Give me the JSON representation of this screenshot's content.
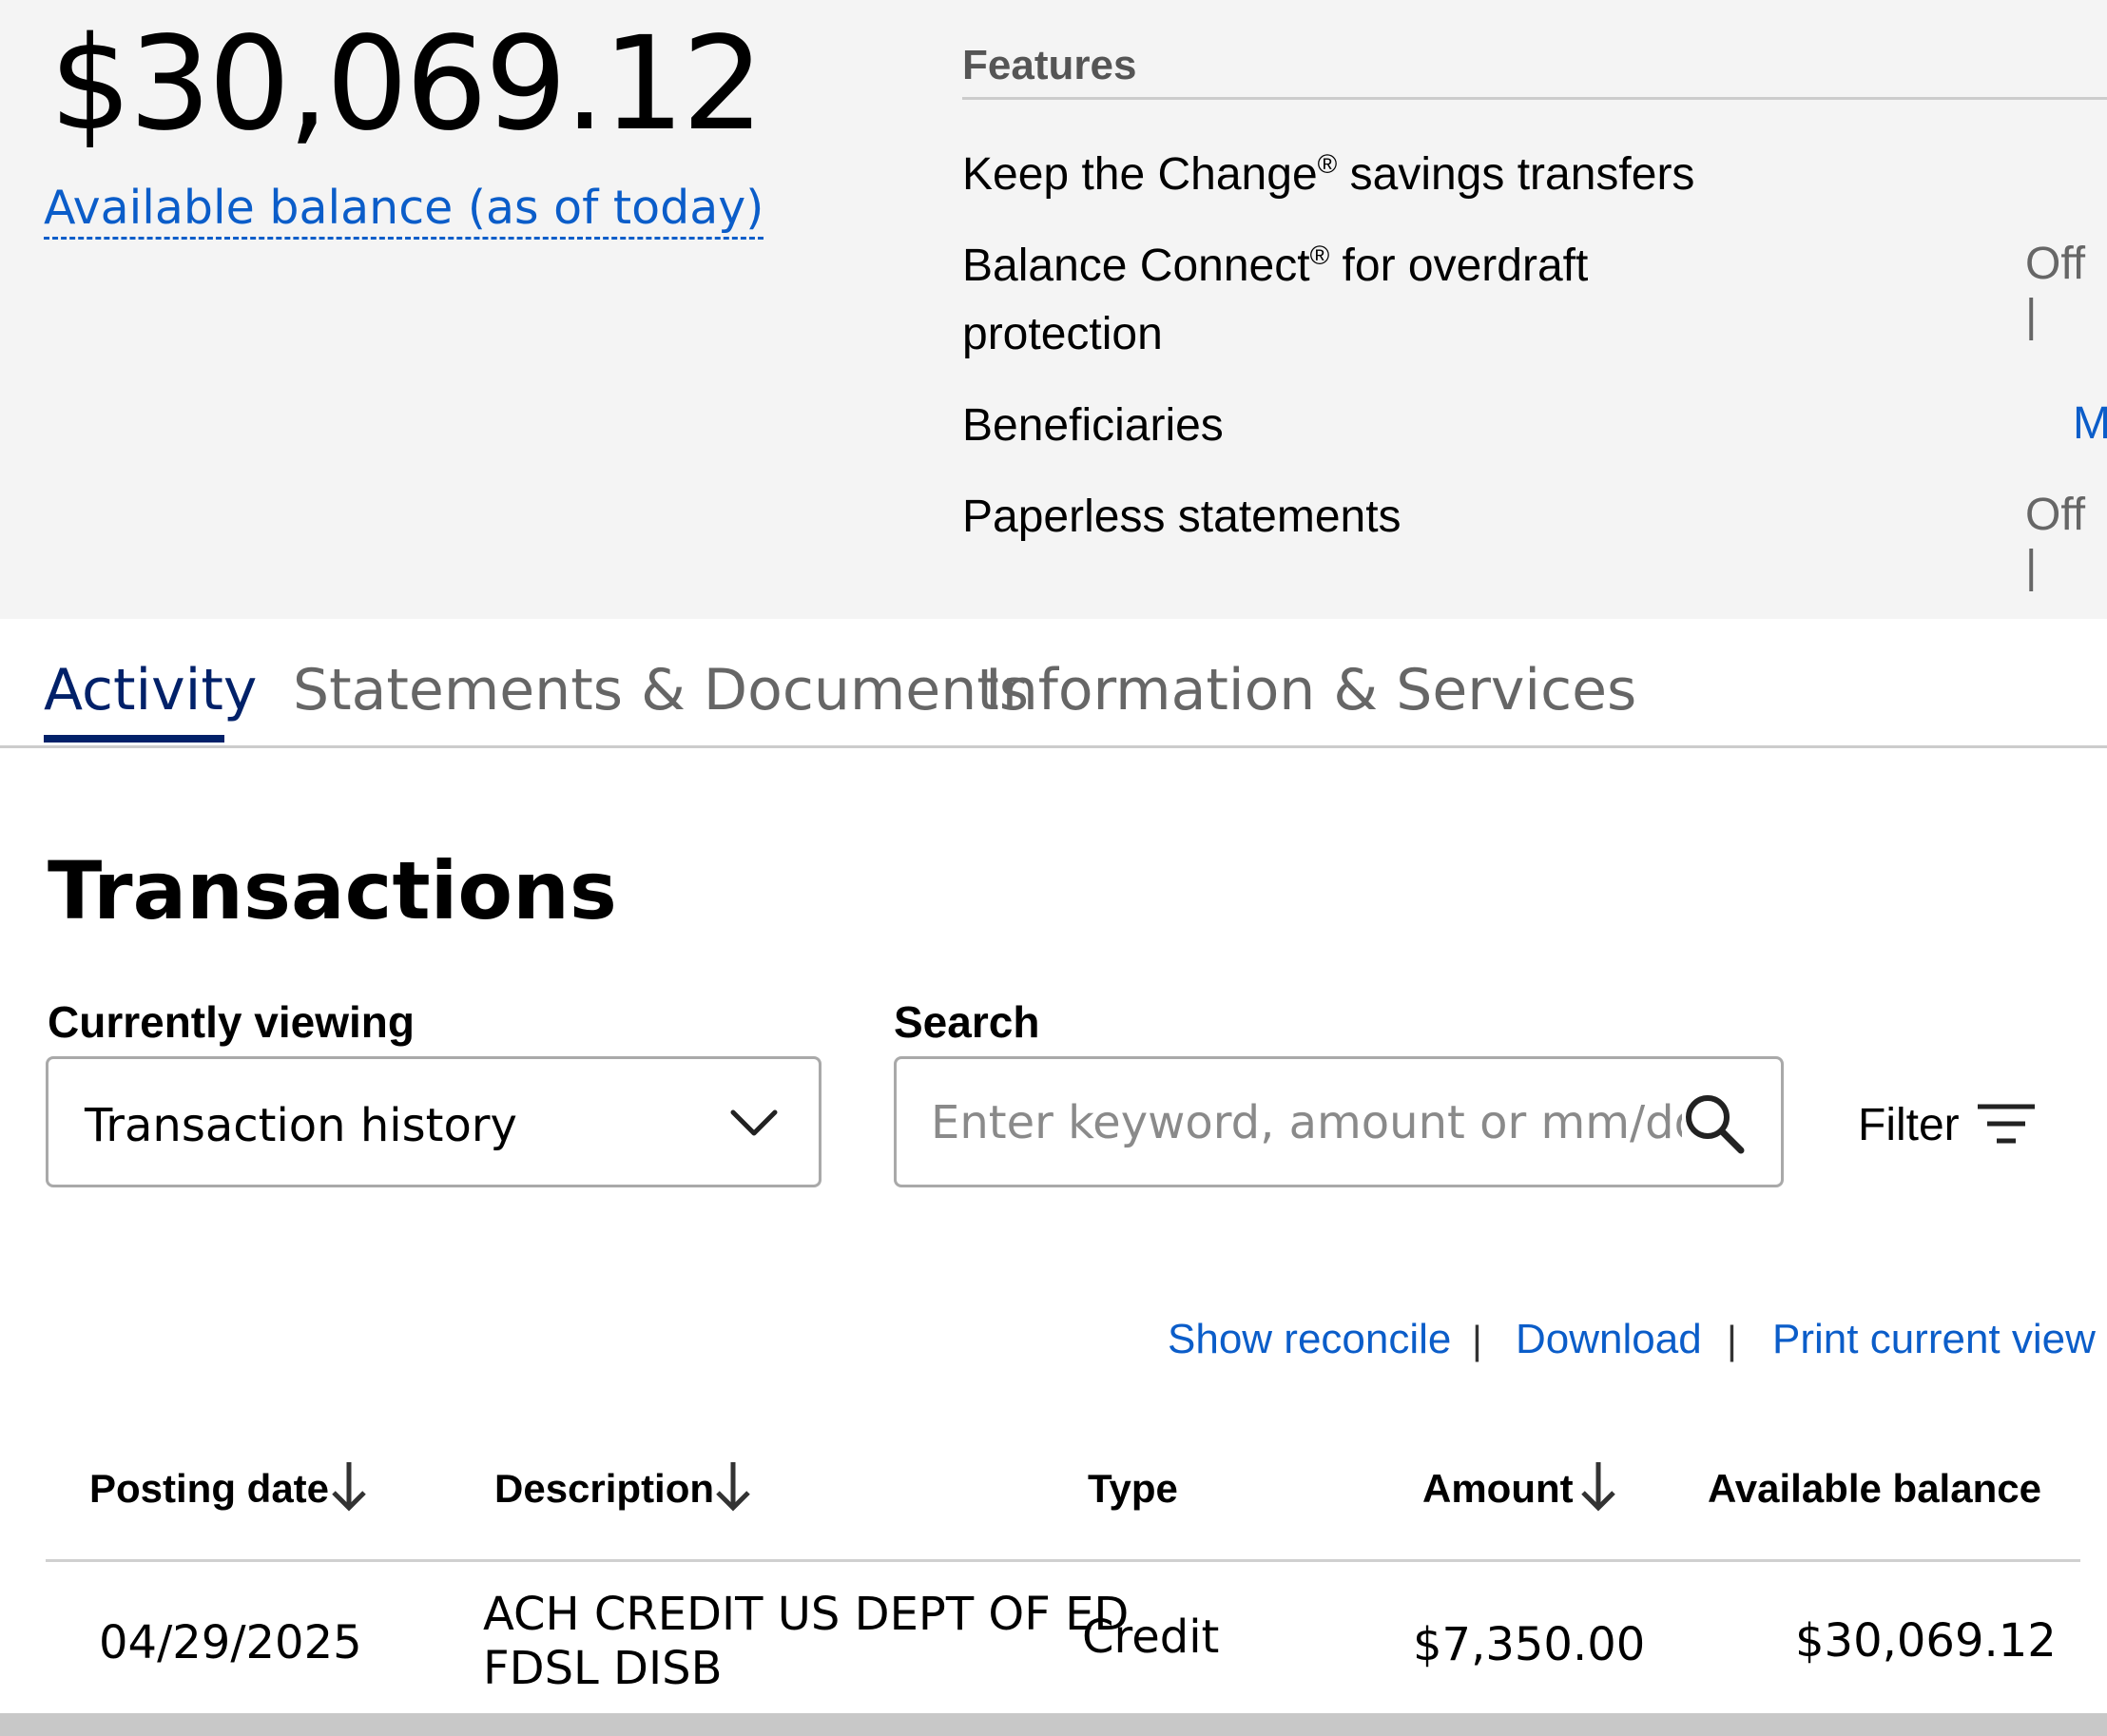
{
  "balance": {
    "amount": "$30,069.12",
    "label": "Available balance (as of today)"
  },
  "features": {
    "heading": "Features",
    "items": [
      {
        "name": "Keep the Change",
        "sup": "®",
        "suffix": " savings transfers",
        "value": ""
      },
      {
        "name": "Balance Connect",
        "sup": "®",
        "suffix": " for overdraft",
        "line2": "protection",
        "value": "Off |"
      },
      {
        "name": "Beneficiaries",
        "value": "M"
      },
      {
        "name": "Paperless statements",
        "value": "Off |"
      }
    ]
  },
  "tabs": [
    {
      "label": "Activity",
      "active": true
    },
    {
      "label": "Statements & Documents",
      "active": false
    },
    {
      "label": "Information & Services",
      "active": false
    }
  ],
  "transactions": {
    "title": "Transactions",
    "viewing_label": "Currently viewing",
    "viewing_value": "Transaction history",
    "search_label": "Search",
    "search_placeholder": "Enter keyword, amount or mm/dd/y…",
    "filter_label": "Filter",
    "actions": [
      "Show reconcile",
      "Download",
      "Print current view"
    ],
    "separator": "|",
    "columns": [
      "Posting date",
      "Description",
      "Type",
      "Amount",
      "Available balance"
    ],
    "rows": [
      {
        "date": "04/29/2025",
        "description_line1": "ACH CREDIT US DEPT OF ED",
        "description_line2": "FDSL DISB",
        "type": "Credit",
        "amount": "$7,350.00",
        "balance": "$30,069.12"
      }
    ]
  },
  "colors": {
    "link": "#0b5dc9",
    "tab_active": "#012169",
    "top_background": "#f4f4f4"
  }
}
